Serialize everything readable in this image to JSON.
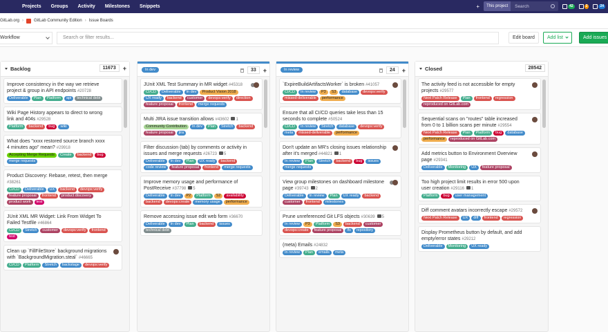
{
  "topbar": {
    "nav": [
      "Projects",
      "Groups",
      "Activity",
      "Milestones",
      "Snippets"
    ],
    "scope": "This project",
    "search_placeholder": "Search",
    "counts": [
      {
        "value": "42",
        "color": "#1aaa55"
      },
      {
        "value": "2",
        "color": "#fc9403"
      },
      {
        "value": "24",
        "color": "#1f78d1"
      }
    ]
  },
  "breadcrumb": [
    "GitLab.org",
    "GitLab Community Edition",
    "Issue Boards"
  ],
  "filterbar": {
    "workflow": "Workflow",
    "filter_placeholder": "Search or filter results...",
    "edit_board": "Edit board",
    "add_list": "Add list",
    "add_issues": "Add issues"
  },
  "lists": [
    {
      "title": "Backlog",
      "count": "11673",
      "cards": [
        {
          "title": "Improve consistency in the way we retrieve project & group in API endpoints",
          "iid": "#20728",
          "labels": [
            [
              "Deliverable",
              "#428bca"
            ],
            [
              "Plan",
              "#44ad8e"
            ],
            [
              "Platform",
              "#44ad8e"
            ],
            [
              "api",
              "#428bca"
            ],
            [
              "technical debt",
              "#7f8c8d"
            ]
          ]
        },
        {
          "title": "Wiki Page History appears to direct to wrong link and 404s",
          "iid": "#29528",
          "labels": [
            [
              "Platform",
              "#44ad8e"
            ],
            [
              "backend",
              "#d9534f"
            ],
            [
              "bug",
              "#cc0033"
            ],
            [
              "wiki",
              "#428bca"
            ]
          ]
        },
        {
          "title": "What does \"xxxx restored source branch xxxx 4 minutes ago\" mean?",
          "iid": "#29918",
          "labels": [
            [
              "Accepting Merge Requests",
              "#69d100"
            ],
            [
              "Create",
              "#44ad8e"
            ],
            [
              "backend",
              "#d9534f"
            ],
            [
              "bug",
              "#cc0033"
            ],
            [
              "merge requests",
              "#428bca"
            ]
          ]
        },
        {
          "title": "Product Discovery: Rebase, retest, then merge",
          "iid": "#38261",
          "labels": [
            [
              "CI/CD",
              "#44ad8e"
            ],
            [
              "Deliverable",
              "#428bca"
            ],
            [
              "UX",
              "#428bca"
            ],
            [
              "backend",
              "#d9534f"
            ],
            [
              "devops:verify",
              "#d9534f"
            ],
            [
              "feature proposal",
              "#ad4363"
            ],
            [
              "frontend",
              "#d9534f"
            ],
            [
              "product discovery",
              "#ad4363"
            ],
            [
              "product work",
              "#ad4363"
            ],
            [
              "test",
              "#d10069"
            ]
          ]
        },
        {
          "title": "JUnit XML MR Widget: Link From Widget To Failed Testfile",
          "iid": "#46864",
          "labels": [
            [
              "CI/CD",
              "#44ad8e"
            ],
            [
              "Stretch",
              "#428bca"
            ],
            [
              "customer",
              "#ad4363"
            ],
            [
              "devops:verify",
              "#d9534f"
            ],
            [
              "frontend",
              "#d9534f"
            ],
            [
              "test",
              "#d10069"
            ]
          ]
        },
        {
          "title": "Clean up `FillFileStore` background migrations with `BackgroundMigration.steal`",
          "iid": "#46665",
          "avatar": true,
          "labels": [
            [
              "CI/CD",
              "#44ad8e"
            ],
            [
              "Platform",
              "#44ad8e"
            ],
            [
              "Stretch",
              "#428bca"
            ],
            [
              "backstage",
              "#428bca"
            ],
            [
              "devops:verify",
              "#d9534f"
            ]
          ]
        }
      ]
    },
    {
      "title": "In dev",
      "count": "33",
      "cards": [
        {
          "title": "JUnit XML Test Summary in MR widget",
          "iid": "#45318",
          "avatar2": true,
          "labels": [
            [
              "CI/CD",
              "#44ad8e"
            ],
            [
              "Deliverable",
              "#428bca"
            ],
            [
              "In dev",
              "#428bca"
            ],
            [
              "Product Vision 2018",
              "#f0ad4e"
            ],
            [
              "UX ready",
              "#428bca"
            ],
            [
              "backend",
              "#d9534f"
            ],
            [
              "customer",
              "#ad4363"
            ],
            [
              "devops:verify",
              "#d9534f"
            ],
            [
              "direction",
              "#d9534f"
            ],
            [
              "feature proposal",
              "#ad4363"
            ],
            [
              "frontend",
              "#d9534f"
            ],
            [
              "merge requests",
              "#428bca"
            ]
          ]
        },
        {
          "title": "Multi JIRA issue transition allows",
          "iid": "#43602",
          "meta": "1",
          "labels": [
            [
              "Community Contribution",
              "#a8d695"
            ],
            [
              "In dev",
              "#428bca"
            ],
            [
              "Plan",
              "#44ad8e"
            ],
            [
              "Stretch",
              "#428bca"
            ],
            [
              "backend",
              "#d9534f"
            ],
            [
              "feature proposal",
              "#ad4363"
            ],
            [
              "jira",
              "#428bca"
            ]
          ]
        },
        {
          "title": "Filter discussion (tab) by comments or activity in issues and merge requests",
          "iid": "#26723",
          "meta": "5",
          "labels": [
            [
              "Deliverable",
              "#428bca"
            ],
            [
              "In dev",
              "#428bca"
            ],
            [
              "Plan",
              "#44ad8e"
            ],
            [
              "UX ready",
              "#428bca"
            ],
            [
              "backend",
              "#d9534f"
            ],
            [
              "code review",
              "#428bca"
            ],
            [
              "feature proposal",
              "#ad4363"
            ],
            [
              "frontend",
              "#d9534f"
            ],
            [
              "merge requests",
              "#428bca"
            ]
          ]
        },
        {
          "title": "Improve memory usage and performance of PostReceive",
          "iid": "#37798",
          "meta": "5",
          "labels": [
            [
              "Deliverable",
              "#428bca"
            ],
            [
              "In dev",
              "#428bca"
            ],
            [
              "P2",
              "#f0ad4e"
            ],
            [
              "Platform",
              "#44ad8e"
            ],
            [
              "S2",
              "#f0ad4e"
            ],
            [
              "availability",
              "#cc0033"
            ],
            [
              "backend",
              "#d9534f"
            ],
            [
              "devops:create",
              "#d9534f"
            ],
            [
              "memory usage",
              "#428bca"
            ],
            [
              "performance",
              "#f0ad4e"
            ]
          ]
        },
        {
          "title": "Remove accessing issue edit web form",
          "iid": "#36670",
          "labels": [
            [
              "Deliverable",
              "#428bca"
            ],
            [
              "In dev",
              "#428bca"
            ],
            [
              "Plan",
              "#44ad8e"
            ],
            [
              "backend",
              "#d9534f"
            ],
            [
              "issues",
              "#428bca"
            ],
            [
              "technical debt",
              "#7f8c8d"
            ]
          ]
        }
      ]
    },
    {
      "title": "In review",
      "count": "24",
      "cards": [
        {
          "title": "`ExpireBuildArtifactsWorker` is broken",
          "iid": "#41057",
          "avatar": true,
          "labels": [
            [
              "CI/CD",
              "#44ad8e"
            ],
            [
              "In review",
              "#428bca"
            ],
            [
              "P3",
              "#f0ad4e"
            ],
            [
              "S3",
              "#f0ad4e"
            ],
            [
              "database",
              "#428bca"
            ],
            [
              "devops:verify",
              "#d9534f"
            ],
            [
              "missed-deliverable",
              "#d9534f"
            ],
            [
              "performance",
              "#f0ad4e"
            ]
          ]
        },
        {
          "title": "Ensure that all CI/CD queries take less than 15 seconds to complete",
          "iid": "#50524",
          "labels": [
            [
              "CI/CD",
              "#44ad8e"
            ],
            [
              "In review",
              "#428bca"
            ],
            [
              "Stretch",
              "#428bca"
            ],
            [
              "database",
              "#428bca"
            ],
            [
              "devops:verify",
              "#d9534f"
            ],
            [
              "meta",
              "#428bca"
            ],
            [
              "missed-deliverable",
              "#d9534f"
            ],
            [
              "performance",
              "#f0ad4e"
            ]
          ]
        },
        {
          "title": "Don't update an MR's closing issues relationship after it's merged",
          "iid": "#44821",
          "meta": "1",
          "avatar": true,
          "labels": [
            [
              "In review",
              "#428bca"
            ],
            [
              "Plan",
              "#44ad8e"
            ],
            [
              "Stretch",
              "#428bca"
            ],
            [
              "backend",
              "#d9534f"
            ],
            [
              "bug",
              "#cc0033"
            ],
            [
              "issues",
              "#428bca"
            ],
            [
              "merge requests",
              "#428bca"
            ]
          ]
        },
        {
          "title": "View group milestones on dashboard milestone page",
          "iid": "#39743",
          "meta": "2",
          "avatar2": true,
          "labels": [
            [
              "Deliverable",
              "#428bca"
            ],
            [
              "In review",
              "#428bca"
            ],
            [
              "Plan",
              "#44ad8e"
            ],
            [
              "UX ready",
              "#428bca"
            ],
            [
              "backend",
              "#d9534f"
            ],
            [
              "customer",
              "#ad4363"
            ],
            [
              "frontend",
              "#d9534f"
            ],
            [
              "milestones",
              "#428bca"
            ]
          ]
        },
        {
          "title": "Prune unreferenced Git LFS objects",
          "iid": "#30639",
          "meta": "5",
          "labels": [
            [
              "In review",
              "#428bca"
            ],
            [
              "P3",
              "#f0ad4e"
            ],
            [
              "Platform",
              "#44ad8e"
            ],
            [
              "S3",
              "#f0ad4e"
            ],
            [
              "backend",
              "#d9534f"
            ],
            [
              "customer",
              "#ad4363"
            ],
            [
              "devops:create",
              "#d9534f"
            ],
            [
              "feature proposal",
              "#ad4363"
            ],
            [
              "lfs",
              "#428bca"
            ],
            [
              "repository",
              "#428bca"
            ]
          ]
        },
        {
          "title": "(meta) Emails",
          "iid": "#24832",
          "labels": [
            [
              "In review",
              "#428bca"
            ],
            [
              "Plan",
              "#44ad8e"
            ],
            [
              "emails",
              "#428bca"
            ],
            [
              "meta",
              "#428bca"
            ]
          ]
        }
      ]
    },
    {
      "title": "Closed",
      "count": "28542",
      "cards": [
        {
          "title": "The activity feed is not accessible for empty projects",
          "iid": "#29577",
          "avatar": true,
          "labels": [
            [
              "Next Patch Release",
              "#d9534f"
            ],
            [
              "Plan",
              "#44ad8e"
            ],
            [
              "frontend",
              "#d9534f"
            ],
            [
              "regression",
              "#d9534f"
            ],
            [
              "reproduced on GitLab.com",
              "#ad4363"
            ]
          ]
        },
        {
          "title": "Sequential scans on \"routes\" table increased from 0 to 1 billion scans per minute",
          "iid": "#29554",
          "avatar": true,
          "labels": [
            [
              "Next Patch Release",
              "#d9534f"
            ],
            [
              "Plan",
              "#44ad8e"
            ],
            [
              "Platform",
              "#44ad8e"
            ],
            [
              "bug",
              "#cc0033"
            ],
            [
              "database",
              "#428bca"
            ],
            [
              "performance",
              "#f0ad4e"
            ],
            [
              "reproduced on GitLab.com",
              "#ad4363"
            ]
          ]
        },
        {
          "title": "Add metrics button to Environment Overview page",
          "iid": "#29341",
          "avatar": true,
          "labels": [
            [
              "Deliverable",
              "#428bca"
            ],
            [
              "Monitoring",
              "#44ad8e"
            ],
            [
              "UX",
              "#428bca"
            ],
            [
              "feature proposal",
              "#ad4363"
            ]
          ]
        },
        {
          "title": "Too high project limit results in error 500 upon user creation",
          "iid": "#29116",
          "meta": "1",
          "labels": [
            [
              "Platform",
              "#44ad8e"
            ],
            [
              "bug",
              "#cc0033"
            ],
            [
              "user management",
              "#428bca"
            ]
          ]
        },
        {
          "title": "Diff comment avatars incorrectly escape",
          "iid": "#29572",
          "avatar": true,
          "labels": [
            [
              "Next Patch Release",
              "#d9534f"
            ],
            [
              "UX",
              "#428bca"
            ],
            [
              "diff",
              "#428bca"
            ],
            [
              "frontend",
              "#d9534f"
            ],
            [
              "regression",
              "#d9534f"
            ]
          ]
        },
        {
          "title": "Display Prometheus button by default, and add empty/error states",
          "iid": "#29212",
          "labels": [
            [
              "Deliverable",
              "#428bca"
            ],
            [
              "Monitoring",
              "#44ad8e"
            ],
            [
              "UX ready",
              "#428bca"
            ]
          ]
        }
      ]
    }
  ]
}
